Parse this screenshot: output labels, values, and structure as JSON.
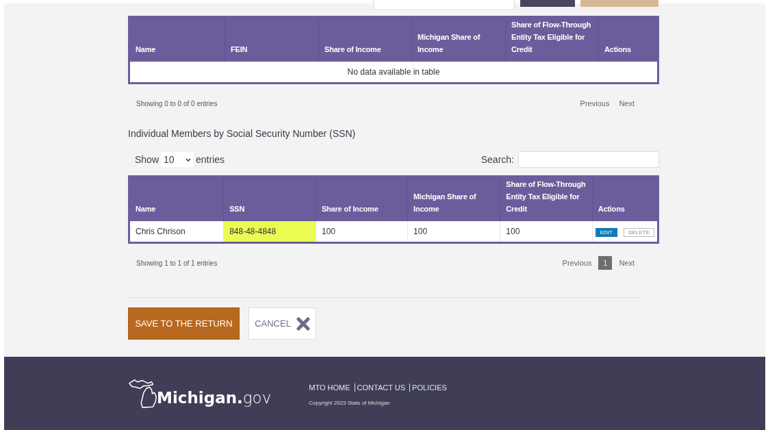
{
  "tables": [
    {
      "columns": [
        "Name",
        "FEIN",
        "Share of Income",
        "Michigan Share of Income",
        "Share of Flow-Through Entity Tax Eligible for Credit",
        "Actions"
      ],
      "empty_message": "No data available in table",
      "info": "Showing 0 to 0 of 0 entries",
      "pagination": {
        "previous": "Previous",
        "next": "Next"
      }
    },
    {
      "heading": "Individual Members by Social Security Number (SSN)",
      "length_control": {
        "show": "Show",
        "value": "10",
        "entries": "entries"
      },
      "search_label": "Search:",
      "columns": [
        "Name",
        "SSN",
        "Share of Income",
        "Michigan Share of Income",
        "Share of Flow-Through Entity Tax Eligible for Credit",
        "Actions"
      ],
      "rows": [
        {
          "cells": [
            {
              "text": "Chris Chrison",
              "highlighted": false
            },
            {
              "text": "848-48-4848",
              "highlighted": true
            },
            {
              "text": "100",
              "highlighted": false
            },
            {
              "text": "100",
              "highlighted": false
            },
            {
              "text": "100",
              "highlighted": false
            }
          ],
          "actions": [
            {
              "label": "EDIT",
              "kind": "primary"
            },
            {
              "label": "DELETE",
              "kind": "outline"
            }
          ]
        }
      ],
      "info": "Showing 1 to 1 of 1 entries",
      "pagination": {
        "previous": "Previous",
        "next": "Next",
        "pages": [
          {
            "label": "1",
            "selected": true
          }
        ]
      }
    }
  ],
  "buttons": [
    {
      "label": "SAVE TO THE RETURN",
      "kind": "primary"
    },
    {
      "label": "CANCEL",
      "kind": "cancel"
    }
  ],
  "footer": {
    "logo": {
      "bold": "Michigan.",
      "light": "gov"
    },
    "links": [
      "MTO HOME",
      "CONTACT US",
      "POLICIES"
    ],
    "copyright": "Copyright 2023 State of Michigan"
  }
}
